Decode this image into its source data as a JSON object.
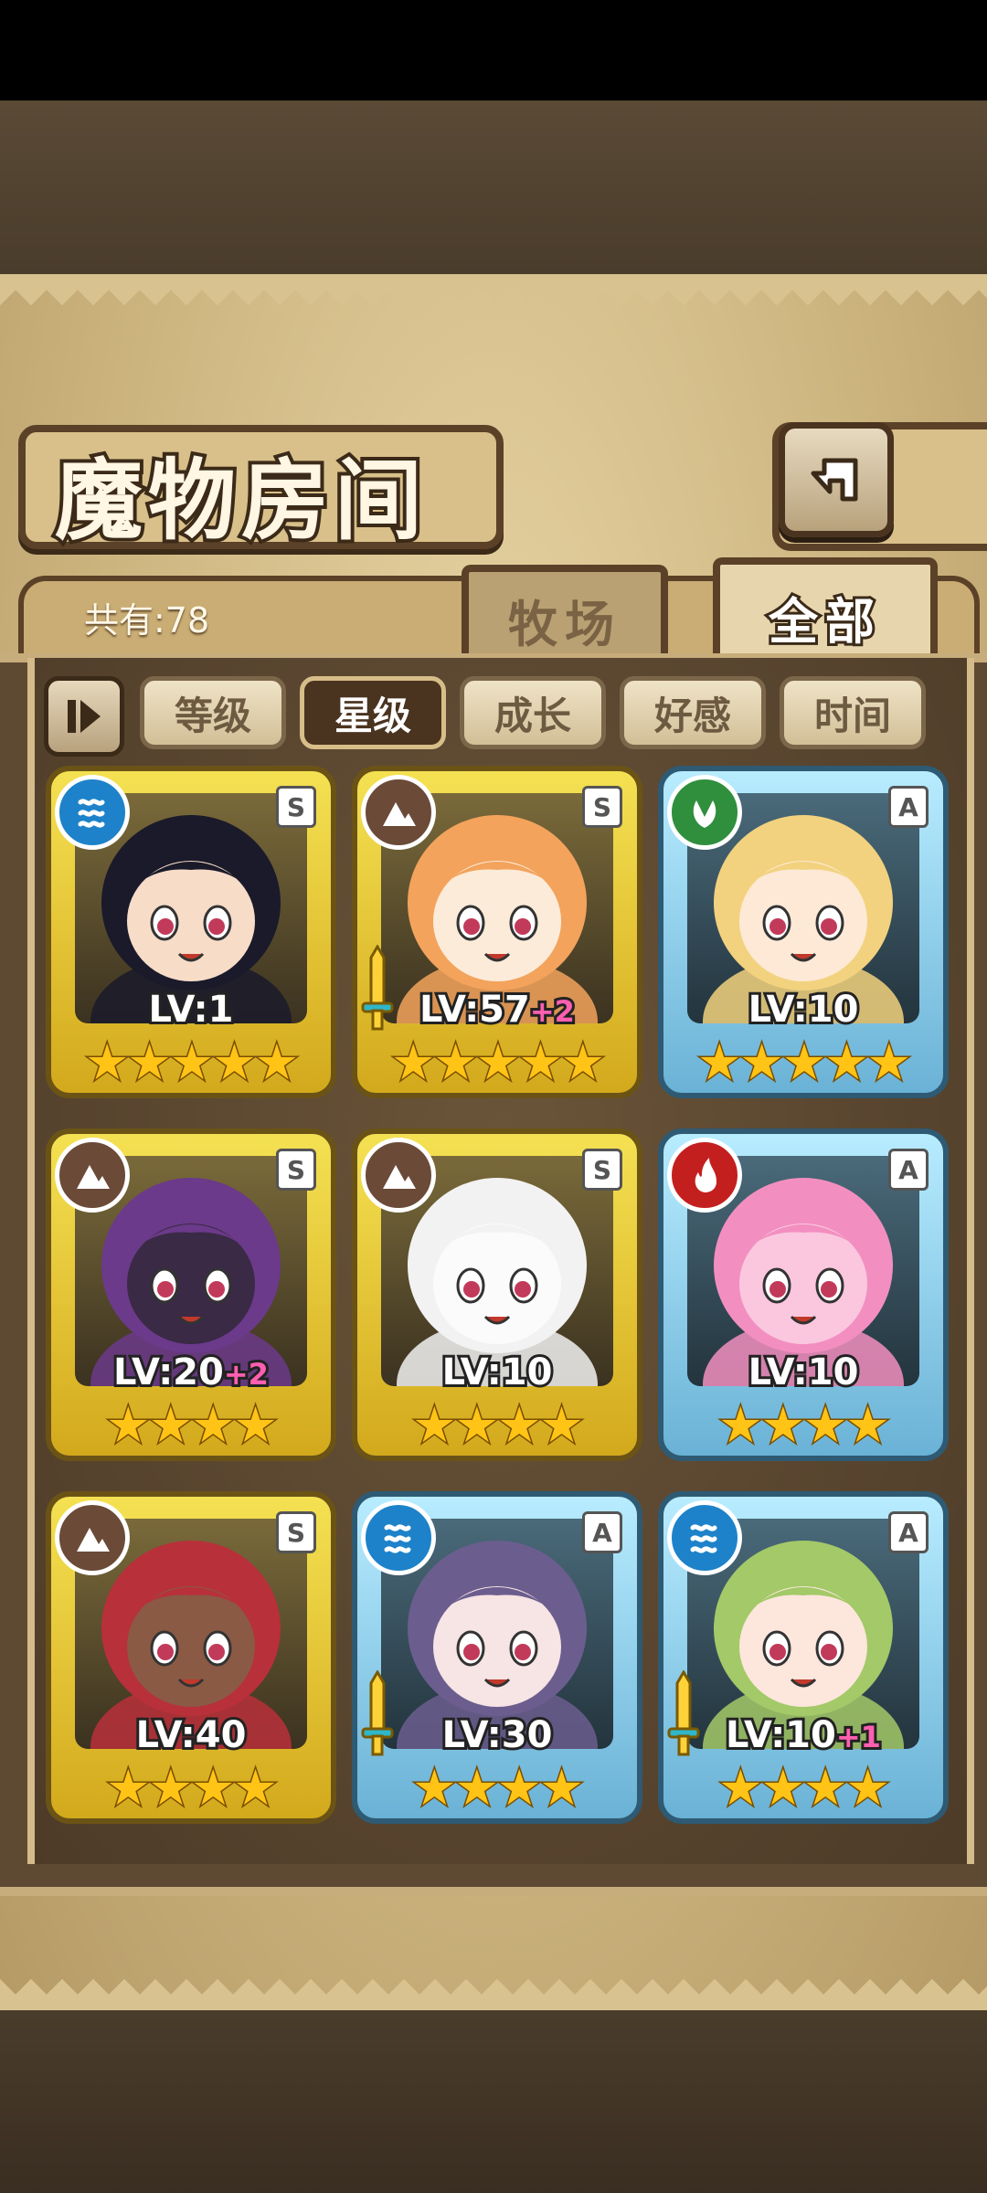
{
  "header": {
    "title": "魔物房间",
    "total_label": "共有:78"
  },
  "tabs": [
    {
      "label": "牧场",
      "active": false
    },
    {
      "label": "全部",
      "active": true
    }
  ],
  "filters": [
    {
      "label": "等级",
      "active": false
    },
    {
      "label": "星级",
      "active": true
    },
    {
      "label": "成长",
      "active": false
    },
    {
      "label": "好感",
      "active": false
    },
    {
      "label": "时间",
      "active": false
    }
  ],
  "cards": [
    {
      "element": "water",
      "rank": "S",
      "frame": "gold",
      "level": "LV:1",
      "bonus": "",
      "stars": 5,
      "star_text": "★★★★★",
      "equipped": false,
      "hair": "#1a1a2a",
      "skin": "#f7dcc8"
    },
    {
      "element": "earth",
      "rank": "S",
      "frame": "gold",
      "level": "LV:57",
      "bonus": "+2",
      "stars": 5,
      "star_text": "★★★★★",
      "equipped": true,
      "hair": "#f3a35c",
      "skin": "#fdebd9"
    },
    {
      "element": "wood",
      "rank": "A",
      "frame": "blue",
      "level": "LV:10",
      "bonus": "",
      "stars": 5,
      "star_text": "★★★★★",
      "equipped": false,
      "hair": "#f2d27e",
      "skin": "#fde9d6"
    },
    {
      "element": "earth",
      "rank": "S",
      "frame": "gold",
      "level": "LV:20",
      "bonus": "+2",
      "stars": 4,
      "star_text": "★★★★",
      "equipped": false,
      "hair": "#6b3a8a",
      "skin": "#3a2a45"
    },
    {
      "element": "earth",
      "rank": "S",
      "frame": "gold",
      "level": "LV:10",
      "bonus": "",
      "stars": 4,
      "star_text": "★★★★",
      "equipped": false,
      "hair": "#f2f2f2",
      "skin": "#fbfbfb"
    },
    {
      "element": "fire",
      "rank": "A",
      "frame": "blue",
      "level": "LV:10",
      "bonus": "",
      "stars": 4,
      "star_text": "★★★★",
      "equipped": false,
      "hair": "#f28fc0",
      "skin": "#fbc7de"
    },
    {
      "element": "earth",
      "rank": "S",
      "frame": "gold",
      "level": "LV:40",
      "bonus": "",
      "stars": 4,
      "star_text": "★★★★",
      "equipped": false,
      "hair": "#b8303a",
      "skin": "#8a5a45"
    },
    {
      "element": "water",
      "rank": "A",
      "frame": "blue",
      "level": "LV:30",
      "bonus": "",
      "stars": 4,
      "star_text": "★★★★",
      "equipped": true,
      "hair": "#6b5e8e",
      "skin": "#f7e4e4"
    },
    {
      "element": "water",
      "rank": "A",
      "frame": "blue",
      "level": "LV:10",
      "bonus": "+1",
      "stars": 4,
      "star_text": "★★★★",
      "equipped": true,
      "hair": "#a3c968",
      "skin": "#fde6dc"
    }
  ]
}
